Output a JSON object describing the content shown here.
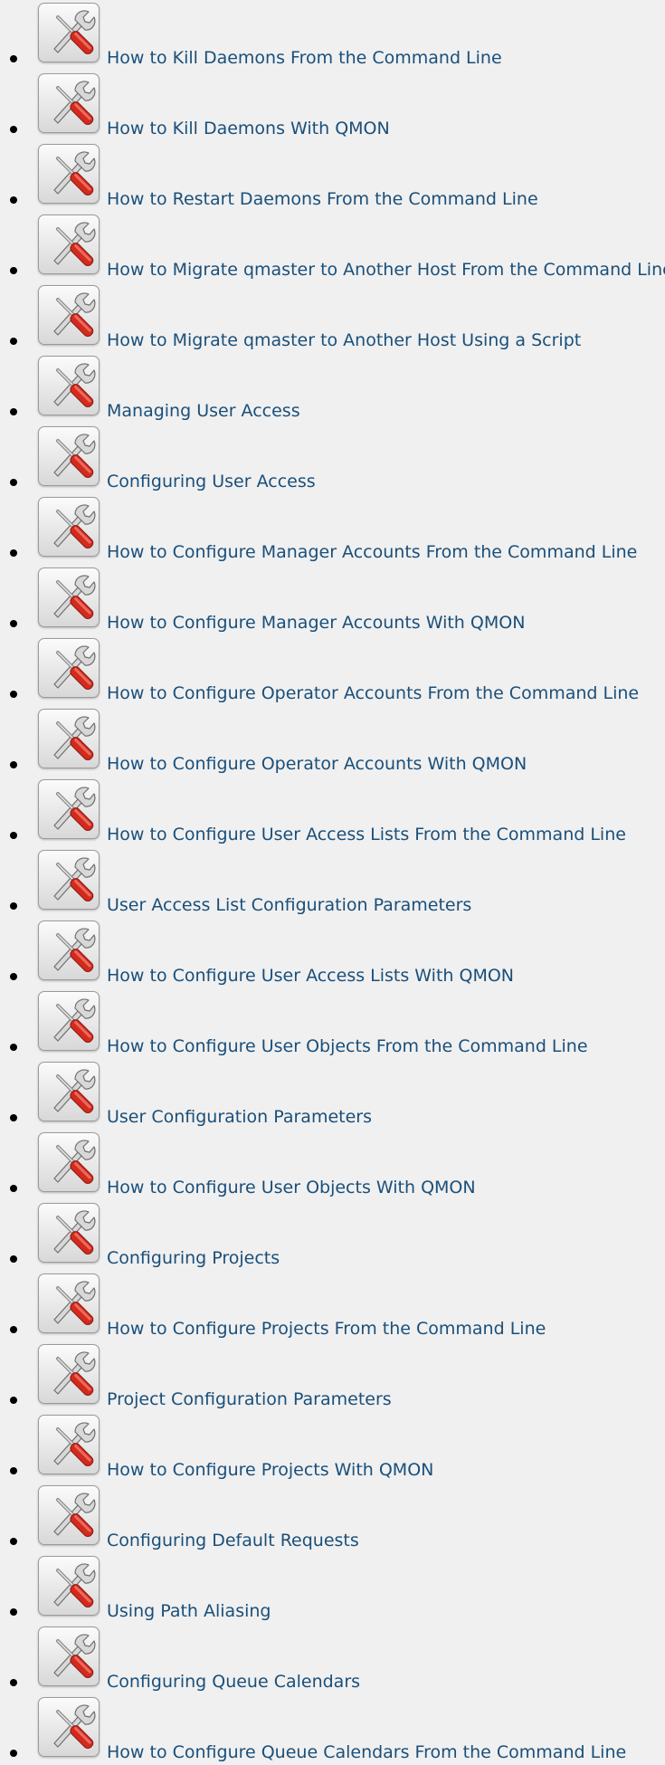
{
  "topics": [
    {
      "label": "How to Kill Daemons From the Command Line"
    },
    {
      "label": "How to Kill Daemons With QMON"
    },
    {
      "label": "How to Restart Daemons From the Command Line"
    },
    {
      "label": "How to Migrate qmaster to Another Host From the Command Line"
    },
    {
      "label": "How to Migrate qmaster to Another Host Using a Script"
    },
    {
      "label": "Managing User Access"
    },
    {
      "label": "Configuring User Access"
    },
    {
      "label": "How to Configure Manager Accounts From the Command Line"
    },
    {
      "label": "How to Configure Manager Accounts With QMON"
    },
    {
      "label": "How to Configure Operator Accounts From the Command Line"
    },
    {
      "label": "How to Configure Operator Accounts With QMON"
    },
    {
      "label": "How to Configure User Access Lists From the Command Line"
    },
    {
      "label": "User Access List Configuration Parameters"
    },
    {
      "label": "How to Configure User Access Lists With QMON"
    },
    {
      "label": "How to Configure User Objects From the Command Line"
    },
    {
      "label": "User Configuration Parameters"
    },
    {
      "label": "How to Configure User Objects With QMON"
    },
    {
      "label": "Configuring Projects"
    },
    {
      "label": "How to Configure Projects From the Command Line"
    },
    {
      "label": "Project Configuration Parameters"
    },
    {
      "label": "How to Configure Projects With QMON"
    },
    {
      "label": "Configuring Default Requests"
    },
    {
      "label": "Using Path Aliasing"
    },
    {
      "label": "Configuring Queue Calendars"
    },
    {
      "label": "How to Configure Queue Calendars From the Command Line"
    }
  ],
  "icon": "wrench-screwdriver-icon",
  "colors": {
    "link": "#1a4f7a",
    "background": "#f0f0f0",
    "screwdriver_handle": "#d42a1e"
  }
}
